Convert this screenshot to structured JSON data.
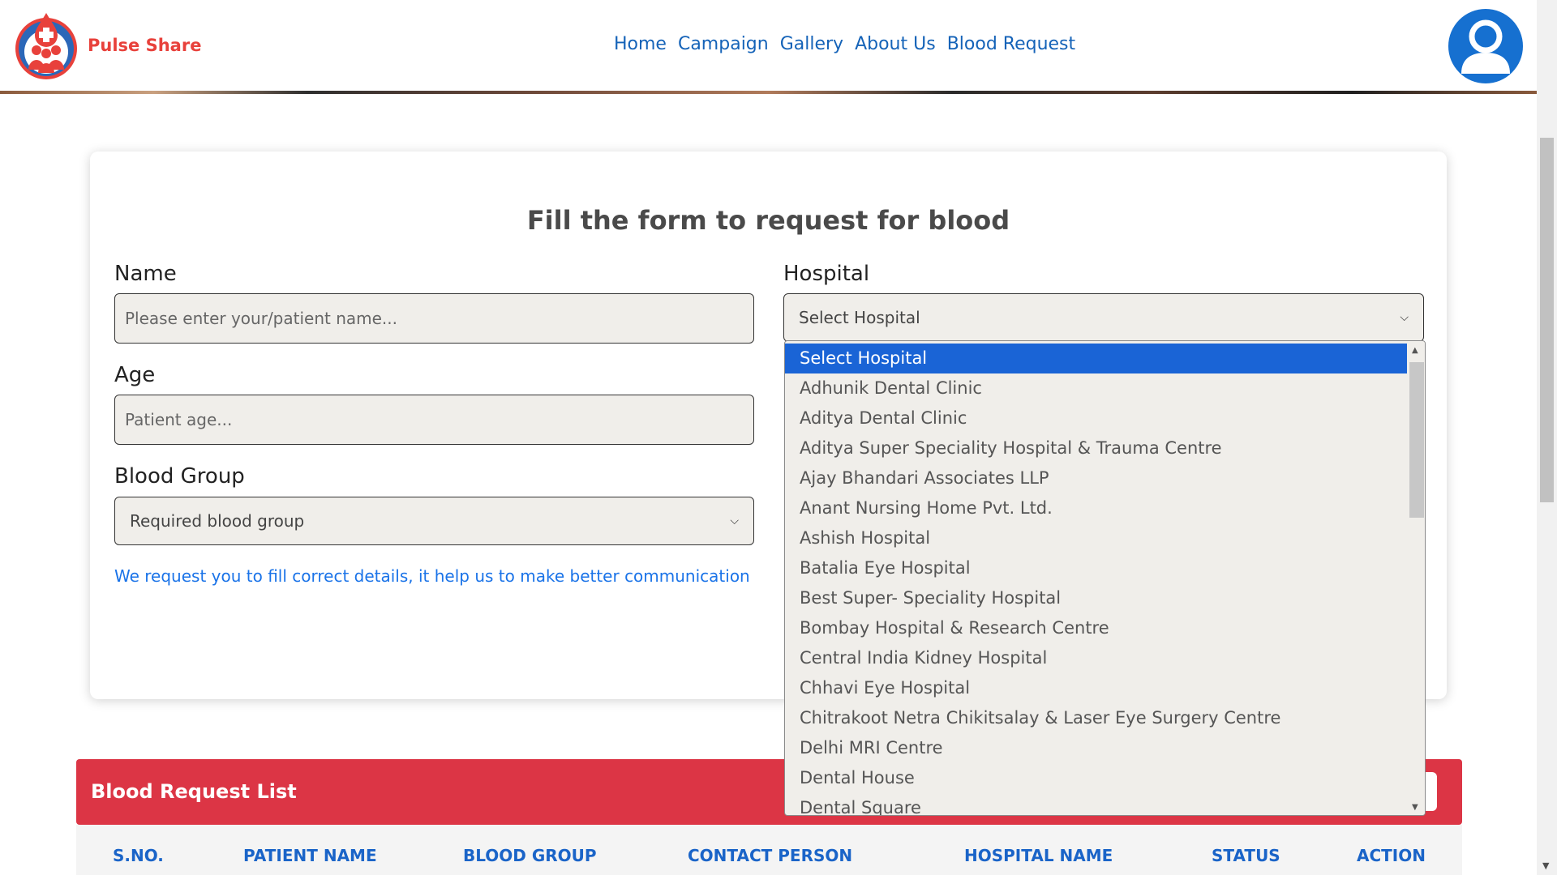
{
  "brand": {
    "name": "Pulse Share"
  },
  "nav": {
    "items": [
      "Home",
      "Campaign",
      "Gallery",
      "About Us",
      "Blood Request"
    ]
  },
  "form": {
    "title": "Fill the form to request for blood",
    "name_label": "Name",
    "name_placeholder": "Please enter your/patient name...",
    "age_label": "Age",
    "age_placeholder": "Patient age...",
    "blood_group_label": "Blood Group",
    "blood_group_value": "Required blood group",
    "hospital_label": "Hospital",
    "hospital_value": "Select Hospital",
    "hint": "We request you to fill correct details, it help us to make better communication"
  },
  "hospital_options": [
    "Select Hospital",
    "Adhunik Dental Clinic",
    "Aditya Dental Clinic",
    "Aditya Super Speciality Hospital & Trauma Centre",
    "Ajay Bhandari Associates LLP",
    "Anant Nursing Home Pvt. Ltd.",
    "Ashish Hospital",
    "Batalia Eye Hospital",
    "Best Super- Speciality Hospital",
    "Bombay Hospital & Research Centre",
    "Central India Kidney Hospital",
    "Chhavi Eye Hospital",
    "Chitrakoot Netra Chikitsalay & Laser Eye Surgery Centre",
    "Delhi MRI Centre",
    "Dental House",
    "Dental Square"
  ],
  "blood_request_list": {
    "title": "Blood Request List",
    "columns": [
      "S.NO.",
      "PATIENT NAME",
      "BLOOD GROUP",
      "CONTACT PERSON",
      "HOSPITAL NAME",
      "STATUS",
      "ACTION"
    ]
  },
  "colors": {
    "brand_red": "#e8413b",
    "nav_blue": "#1563b8",
    "list_header_red": "#dc3545",
    "selected_option": "#1a64d6"
  }
}
